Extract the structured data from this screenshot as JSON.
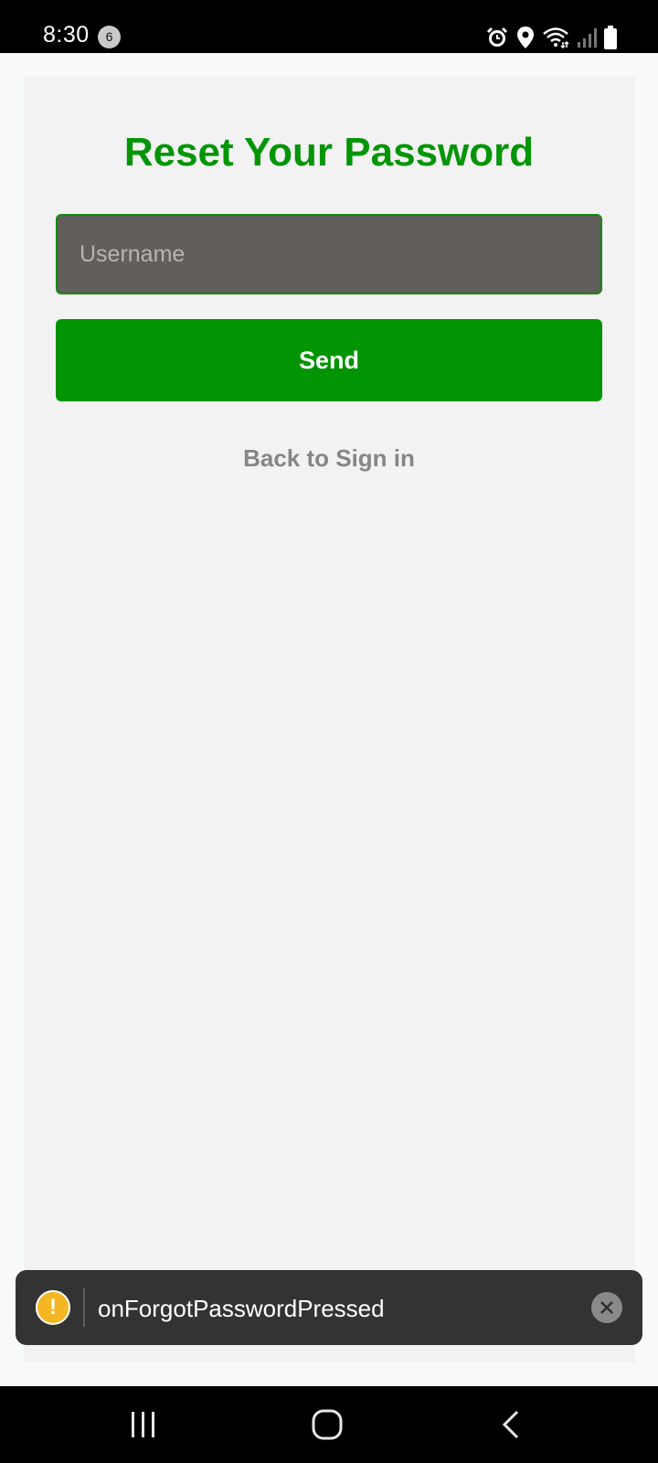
{
  "status_bar": {
    "time": "8:30",
    "notification_count": "6",
    "icons": [
      "alarm-icon",
      "location-icon",
      "wifi-icon",
      "signal-icon",
      "battery-icon"
    ]
  },
  "reset_form": {
    "title": "Reset Your Password",
    "username_placeholder": "Username",
    "username_value": "",
    "send_label": "Send",
    "back_label": "Back to Sign in"
  },
  "toast": {
    "icon": "warning-icon",
    "message": "onForgotPasswordPressed",
    "close_icon": "close-icon"
  },
  "nav_bar": {
    "buttons": [
      "recent-apps-icon",
      "home-icon",
      "back-icon"
    ]
  },
  "colors": {
    "accent": "#039506",
    "button": "#029402",
    "input_bg": "#615e5b",
    "card_bg": "#f2f2f2",
    "toast_bg": "#333333",
    "warning": "#f4b622"
  }
}
